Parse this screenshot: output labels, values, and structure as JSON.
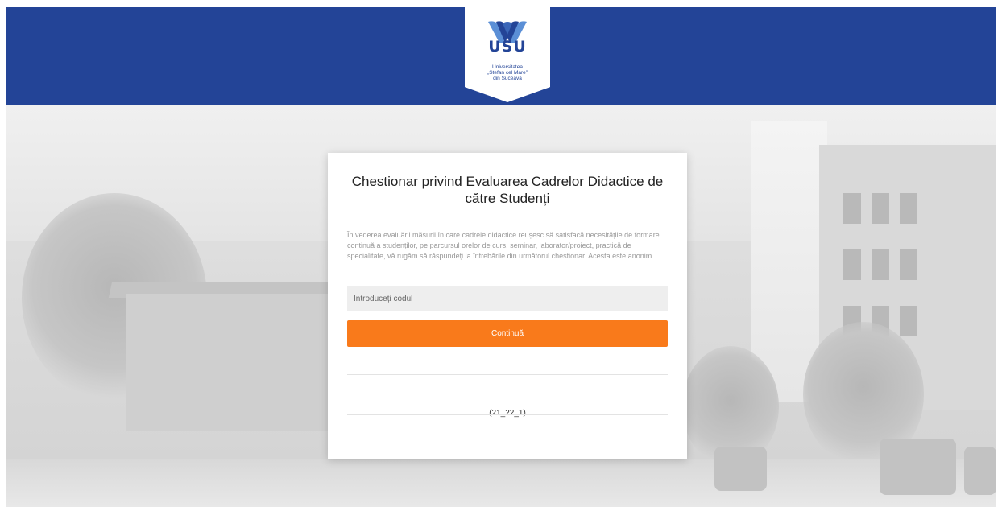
{
  "header": {
    "brand_color": "#234497",
    "logo": {
      "icon": "usv-logo-icon",
      "acronym": "USU",
      "caption_line1": "Universitatea",
      "caption_line2": "„Ștefan cel Mare”",
      "caption_line3": "din Suceava"
    }
  },
  "form": {
    "title": "Chestionar privind Evaluarea Cadrelor Didactice de către Studenți",
    "description": "În vederea evaluării măsurii în care cadrele didactice reușesc să satisfacă necesitățile de formare continuă a studenților, pe parcursul orelor de curs, seminar, laborator/proiect, practică de specialitate, vă rugăm să răspundeți la întrebările din următorul chestionar. Acesta este anonim.",
    "code_input": {
      "value": "",
      "placeholder": "Introduceți codul"
    },
    "continue_label": "Continuă",
    "continue_color": "#f97a1b",
    "version": "(21_22_1)"
  }
}
